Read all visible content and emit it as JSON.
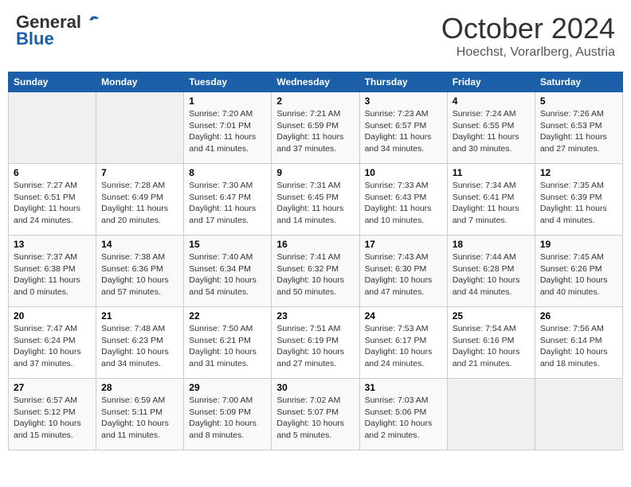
{
  "header": {
    "logo_general": "General",
    "logo_blue": "Blue",
    "month_title": "October 2024",
    "location": "Hoechst, Vorarlberg, Austria"
  },
  "days_of_week": [
    "Sunday",
    "Monday",
    "Tuesday",
    "Wednesday",
    "Thursday",
    "Friday",
    "Saturday"
  ],
  "weeks": [
    [
      {
        "day": "",
        "info": ""
      },
      {
        "day": "",
        "info": ""
      },
      {
        "day": "1",
        "info": "Sunrise: 7:20 AM\nSunset: 7:01 PM\nDaylight: 11 hours and 41 minutes."
      },
      {
        "day": "2",
        "info": "Sunrise: 7:21 AM\nSunset: 6:59 PM\nDaylight: 11 hours and 37 minutes."
      },
      {
        "day": "3",
        "info": "Sunrise: 7:23 AM\nSunset: 6:57 PM\nDaylight: 11 hours and 34 minutes."
      },
      {
        "day": "4",
        "info": "Sunrise: 7:24 AM\nSunset: 6:55 PM\nDaylight: 11 hours and 30 minutes."
      },
      {
        "day": "5",
        "info": "Sunrise: 7:26 AM\nSunset: 6:53 PM\nDaylight: 11 hours and 27 minutes."
      }
    ],
    [
      {
        "day": "6",
        "info": "Sunrise: 7:27 AM\nSunset: 6:51 PM\nDaylight: 11 hours and 24 minutes."
      },
      {
        "day": "7",
        "info": "Sunrise: 7:28 AM\nSunset: 6:49 PM\nDaylight: 11 hours and 20 minutes."
      },
      {
        "day": "8",
        "info": "Sunrise: 7:30 AM\nSunset: 6:47 PM\nDaylight: 11 hours and 17 minutes."
      },
      {
        "day": "9",
        "info": "Sunrise: 7:31 AM\nSunset: 6:45 PM\nDaylight: 11 hours and 14 minutes."
      },
      {
        "day": "10",
        "info": "Sunrise: 7:33 AM\nSunset: 6:43 PM\nDaylight: 11 hours and 10 minutes."
      },
      {
        "day": "11",
        "info": "Sunrise: 7:34 AM\nSunset: 6:41 PM\nDaylight: 11 hours and 7 minutes."
      },
      {
        "day": "12",
        "info": "Sunrise: 7:35 AM\nSunset: 6:39 PM\nDaylight: 11 hours and 4 minutes."
      }
    ],
    [
      {
        "day": "13",
        "info": "Sunrise: 7:37 AM\nSunset: 6:38 PM\nDaylight: 11 hours and 0 minutes."
      },
      {
        "day": "14",
        "info": "Sunrise: 7:38 AM\nSunset: 6:36 PM\nDaylight: 10 hours and 57 minutes."
      },
      {
        "day": "15",
        "info": "Sunrise: 7:40 AM\nSunset: 6:34 PM\nDaylight: 10 hours and 54 minutes."
      },
      {
        "day": "16",
        "info": "Sunrise: 7:41 AM\nSunset: 6:32 PM\nDaylight: 10 hours and 50 minutes."
      },
      {
        "day": "17",
        "info": "Sunrise: 7:43 AM\nSunset: 6:30 PM\nDaylight: 10 hours and 47 minutes."
      },
      {
        "day": "18",
        "info": "Sunrise: 7:44 AM\nSunset: 6:28 PM\nDaylight: 10 hours and 44 minutes."
      },
      {
        "day": "19",
        "info": "Sunrise: 7:45 AM\nSunset: 6:26 PM\nDaylight: 10 hours and 40 minutes."
      }
    ],
    [
      {
        "day": "20",
        "info": "Sunrise: 7:47 AM\nSunset: 6:24 PM\nDaylight: 10 hours and 37 minutes."
      },
      {
        "day": "21",
        "info": "Sunrise: 7:48 AM\nSunset: 6:23 PM\nDaylight: 10 hours and 34 minutes."
      },
      {
        "day": "22",
        "info": "Sunrise: 7:50 AM\nSunset: 6:21 PM\nDaylight: 10 hours and 31 minutes."
      },
      {
        "day": "23",
        "info": "Sunrise: 7:51 AM\nSunset: 6:19 PM\nDaylight: 10 hours and 27 minutes."
      },
      {
        "day": "24",
        "info": "Sunrise: 7:53 AM\nSunset: 6:17 PM\nDaylight: 10 hours and 24 minutes."
      },
      {
        "day": "25",
        "info": "Sunrise: 7:54 AM\nSunset: 6:16 PM\nDaylight: 10 hours and 21 minutes."
      },
      {
        "day": "26",
        "info": "Sunrise: 7:56 AM\nSunset: 6:14 PM\nDaylight: 10 hours and 18 minutes."
      }
    ],
    [
      {
        "day": "27",
        "info": "Sunrise: 6:57 AM\nSunset: 5:12 PM\nDaylight: 10 hours and 15 minutes."
      },
      {
        "day": "28",
        "info": "Sunrise: 6:59 AM\nSunset: 5:11 PM\nDaylight: 10 hours and 11 minutes."
      },
      {
        "day": "29",
        "info": "Sunrise: 7:00 AM\nSunset: 5:09 PM\nDaylight: 10 hours and 8 minutes."
      },
      {
        "day": "30",
        "info": "Sunrise: 7:02 AM\nSunset: 5:07 PM\nDaylight: 10 hours and 5 minutes."
      },
      {
        "day": "31",
        "info": "Sunrise: 7:03 AM\nSunset: 5:06 PM\nDaylight: 10 hours and 2 minutes."
      },
      {
        "day": "",
        "info": ""
      },
      {
        "day": "",
        "info": ""
      }
    ]
  ]
}
